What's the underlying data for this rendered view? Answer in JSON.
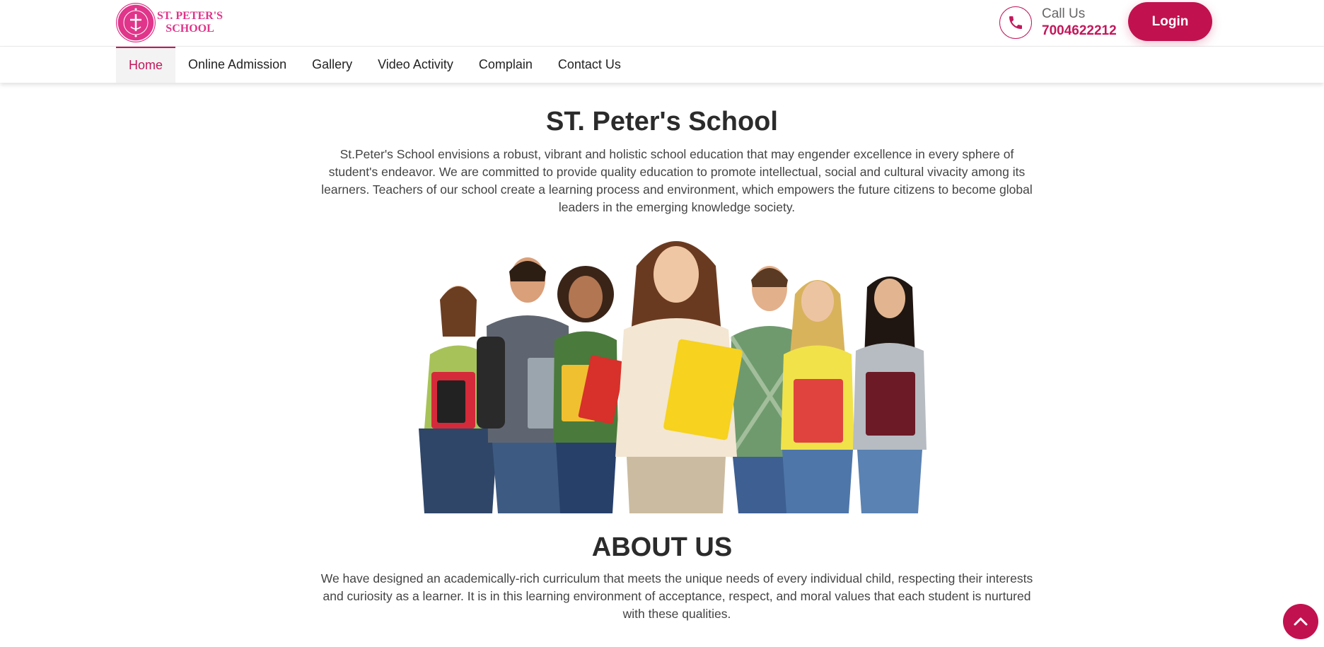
{
  "header": {
    "logo_line1": "ST. PETER'S",
    "logo_line2": "SCHOOL",
    "call_label": "Call Us",
    "call_number": "7004622212",
    "login_label": "Login"
  },
  "nav": {
    "items": [
      {
        "label": "Home",
        "active": true
      },
      {
        "label": "Online Admission"
      },
      {
        "label": "Gallery"
      },
      {
        "label": "Video Activity"
      },
      {
        "label": "Complain"
      },
      {
        "label": "Contact Us"
      }
    ]
  },
  "hero": {
    "title": "ST. Peter's School",
    "text": "St.Peter's School envisions a robust, vibrant and holistic school education that may engender excellence in every sphere of student's endeavor. We are committed to provide quality education to promote intellectual, social and cultural vivacity among its learners. Teachers of our school create a learning process and environment, which empowers the future citizens to become global leaders in the emerging knowledge society."
  },
  "about": {
    "title": "ABOUT US",
    "text": "We have designed an academically-rich curriculum that meets the unique needs of every individual child, respecting their interests and curiosity as a learner. It is in this learning environment of acceptance, respect, and moral values that each student is nurtured with these qualities."
  },
  "colors": {
    "brand": "#c2114f",
    "logo_pink": "#e0358a"
  },
  "icons": {
    "phone": "phone-icon",
    "scroll_top": "chevron-up-icon",
    "logo": "school-seal-logo"
  }
}
